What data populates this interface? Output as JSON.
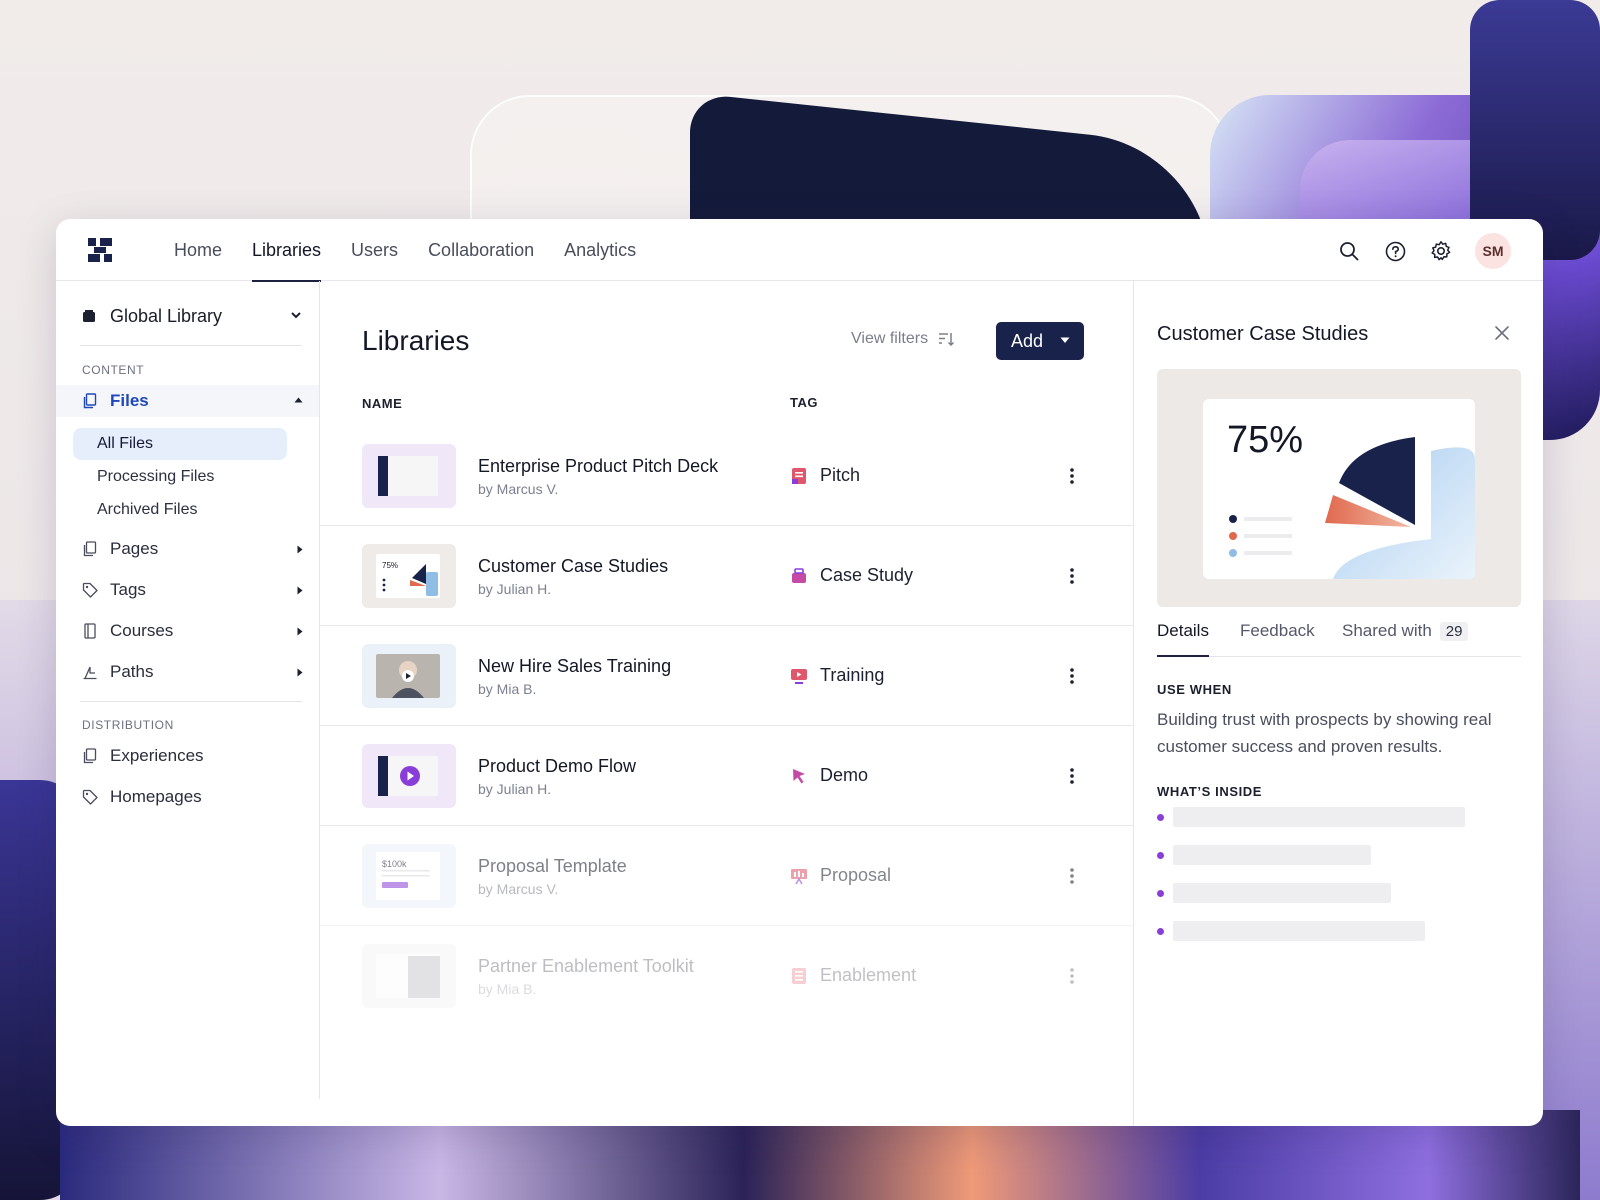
{
  "nav": {
    "items": [
      "Home",
      "Libraries",
      "Users",
      "Collaboration",
      "Analytics"
    ],
    "active": "Libraries"
  },
  "user": {
    "initials": "SM"
  },
  "sidebar": {
    "library_name": "Global Library",
    "content_label": "CONTENT",
    "files_label": "Files",
    "file_subitems": [
      "All Files",
      "Processing Files",
      "Archived Files"
    ],
    "content_items": [
      "Pages",
      "Tags",
      "Courses",
      "Paths"
    ],
    "distribution_label": "DISTRIBUTION",
    "distribution_items": [
      "Experiences",
      "Homepages"
    ]
  },
  "main": {
    "title": "Libraries",
    "view_filters_label": "View filters",
    "add_label": "Add",
    "col_name": "NAME",
    "col_tag": "TAG",
    "rows": [
      {
        "title": "Enterprise Product Pitch Deck",
        "author": "by Marcus V.",
        "tag": "Pitch",
        "tag_icon": "pitch-icon"
      },
      {
        "title": "Customer Case Studies",
        "author": "by Julian H.",
        "tag": "Case Study",
        "tag_icon": "case-study-icon",
        "thumb_text": "75%"
      },
      {
        "title": "New Hire Sales Training",
        "author": "by Mia B.",
        "tag": "Training",
        "tag_icon": "training-icon"
      },
      {
        "title": "Product Demo Flow",
        "author": "by Julian H.",
        "tag": "Demo",
        "tag_icon": "demo-cursor-icon"
      },
      {
        "title": "Proposal Template",
        "author": "by Marcus V.",
        "tag": "Proposal",
        "tag_icon": "proposal-icon",
        "thumb_text": "$100k"
      },
      {
        "title": "Partner Enablement Toolkit",
        "author": "by Mia B.",
        "tag": "Enablement",
        "tag_icon": "enablement-icon"
      }
    ]
  },
  "panel": {
    "title": "Customer Case Studies",
    "preview_percent": "75%",
    "tabs": [
      "Details",
      "Feedback",
      "Shared with"
    ],
    "shared_count": "29",
    "use_when_label": "USE WHEN",
    "use_when_text": "Building trust with prospects by showing real customer success and proven results.",
    "whats_inside_label": "WHAT’S INSIDE"
  },
  "colors": {
    "brand_navy": "#19224a",
    "accent_blue": "#2048b8",
    "purple": "#8a3ed8",
    "coral": "#e0694e",
    "sky": "#8fbde6"
  }
}
